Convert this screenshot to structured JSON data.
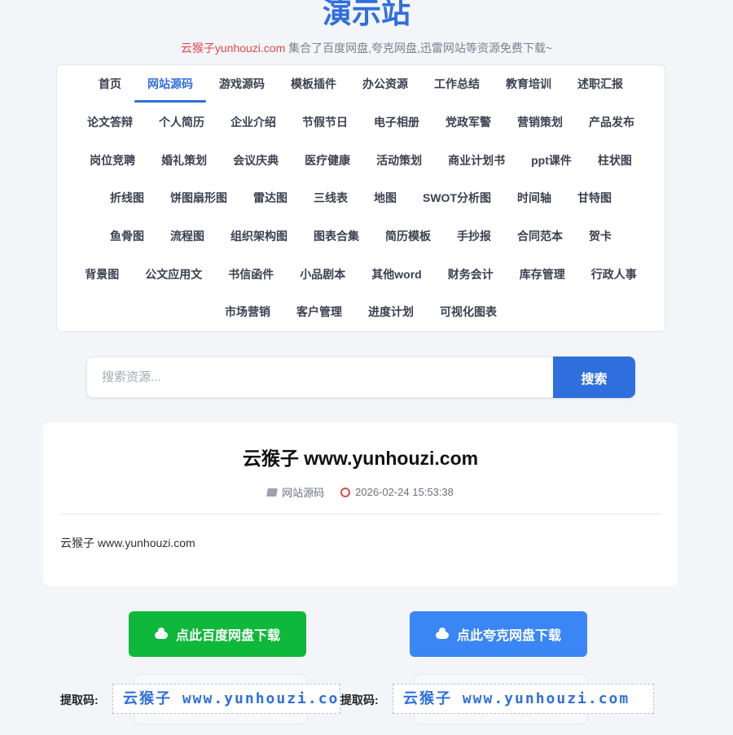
{
  "header": {
    "site_title": "演示站",
    "subtitle_brand": "云猴子yunhouzi.com",
    "subtitle_text": " 集合了百度网盘,夸克网盘,迅雷网站等资源免费下载~"
  },
  "nav": {
    "rows": [
      [
        "首页",
        "网站源码",
        "游戏源码",
        "模板插件",
        "办公资源",
        "工作总结",
        "教育培训",
        "述职汇报"
      ],
      [
        "论文答辩",
        "个人简历",
        "企业介绍",
        "节假节日",
        "电子相册",
        "党政军警",
        "营销策划",
        "产品发布"
      ],
      [
        "岗位竞聘",
        "婚礼策划",
        "会议庆典",
        "医疗健康",
        "活动策划",
        "商业计划书",
        "ppt课件",
        "柱状图"
      ],
      [
        "折线图",
        "饼图扇形图",
        "雷达图",
        "三线表",
        "地图",
        "SWOT分析图",
        "时间轴",
        "甘特图"
      ],
      [
        "鱼骨图",
        "流程图",
        "组织架构图",
        "图表合集",
        "简历模板",
        "手抄报",
        "合同范本",
        "贺卡"
      ],
      [
        "背景图",
        "公文应用文",
        "书信函件",
        "小品剧本",
        "其他word",
        "财务会计",
        "库存管理",
        "行政人事"
      ],
      [
        "市场营销",
        "客户管理",
        "进度计划",
        "可视化图表"
      ]
    ],
    "active": "网站源码"
  },
  "search": {
    "placeholder": "搜索资源...",
    "button_label": "搜索"
  },
  "article": {
    "title": "云猴子 www.yunhouzi.com",
    "category": "网站源码",
    "timestamp": "2026-02-24 15:53:38",
    "body": "云猴子 www.yunhouzi.com"
  },
  "downloads": {
    "baidu_label": "点此百度网盘下载",
    "quark_label": "点此夸克网盘下载",
    "code_label": "提取码:",
    "baidu_code": "云猴子 www.yunhouzi.com",
    "quark_code": "云猴子 www.yunhouzi.com"
  },
  "colors": {
    "accent": "#2f6fdd",
    "brand_red": "#e5484d",
    "baidu_green": "#0eb83a",
    "quark_blue": "#3a86f5"
  },
  "icons": [
    "folder-icon",
    "clock-icon",
    "cloud-icon"
  ]
}
